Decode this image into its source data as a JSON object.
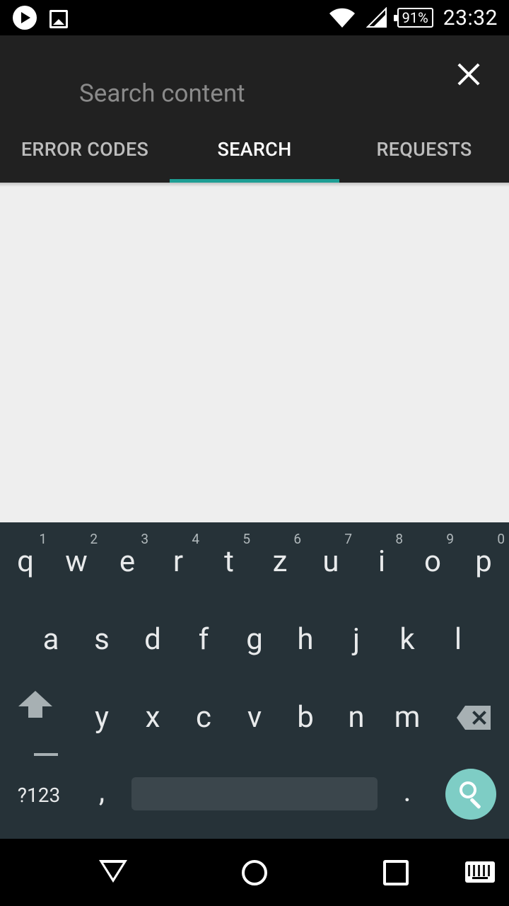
{
  "status_bar": {
    "icons": [
      "play-notification-icon",
      "image-notification-icon",
      "wifi-icon",
      "signal-icon"
    ],
    "battery": "91%",
    "time": "23:32"
  },
  "search": {
    "placeholder": "Search content",
    "value": ""
  },
  "tabs": [
    {
      "label": "ERROR CODES",
      "active": false
    },
    {
      "label": "SEARCH",
      "active": true
    },
    {
      "label": "REQUESTS",
      "active": false
    }
  ],
  "keyboard": {
    "row1": [
      {
        "key": "q",
        "hint": "1"
      },
      {
        "key": "w",
        "hint": "2"
      },
      {
        "key": "e",
        "hint": "3"
      },
      {
        "key": "r",
        "hint": "4"
      },
      {
        "key": "t",
        "hint": "5"
      },
      {
        "key": "z",
        "hint": "6"
      },
      {
        "key": "u",
        "hint": "7"
      },
      {
        "key": "i",
        "hint": "8"
      },
      {
        "key": "o",
        "hint": "9"
      },
      {
        "key": "p",
        "hint": "0"
      }
    ],
    "row2": [
      "a",
      "s",
      "d",
      "f",
      "g",
      "h",
      "j",
      "k",
      "l"
    ],
    "row3": [
      "y",
      "x",
      "c",
      "v",
      "b",
      "n",
      "m"
    ],
    "symbols_label": "?123",
    "comma": ",",
    "period": "."
  },
  "colors": {
    "toolbar_bg": "#212121",
    "accent": "#1e9e94",
    "keyboard_bg": "#263238",
    "search_key": "#7ecdc5",
    "content_bg": "#eeeeee"
  }
}
